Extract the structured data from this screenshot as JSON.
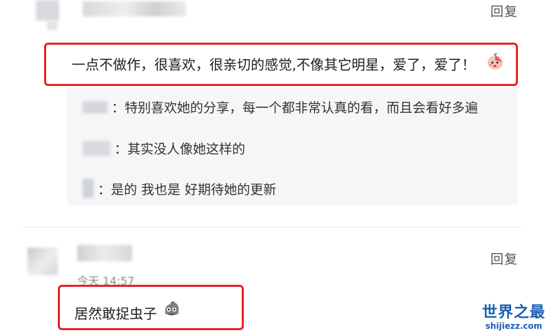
{
  "comment1": {
    "reply_label": "回复",
    "text": "一点不做作，很喜欢，很亲切的感觉,不像其它明星，爱了，爱了！",
    "emoji": "peach-face-emoji",
    "replies": [
      {
        "text": "：特别喜欢她的分享，每一个都非常认真的看，而且会看好多遍"
      },
      {
        "text": "：其实没人像她这样的"
      },
      {
        "text": "：是的 我也是 好期待她的更新"
      }
    ]
  },
  "comment2": {
    "reply_label": "回复",
    "time": "今天 14:57",
    "text": "居然敢捉虫子",
    "emoji": "blob-face-emoji"
  },
  "watermark": {
    "title": "世界之最",
    "url": "shijiezz.com"
  },
  "colors": {
    "highlight": "#e5222a",
    "reply_bg": "#f5f6f8",
    "watermark": "#1a5fb4"
  }
}
